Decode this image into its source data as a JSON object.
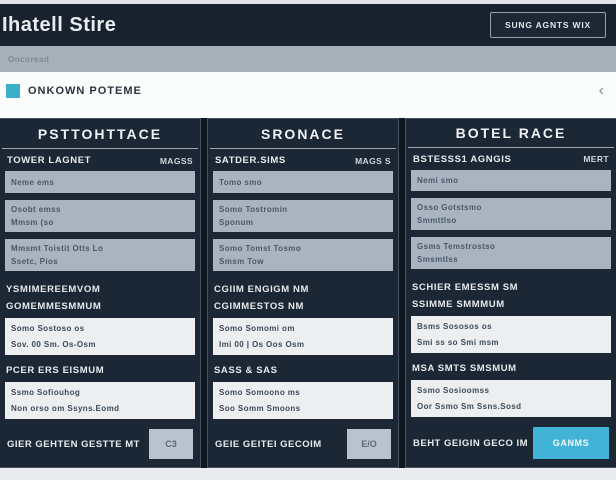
{
  "header": {
    "title": "Ihatell Stire",
    "action_button": "SUNG AGNTS WIX"
  },
  "breadcrumb": {
    "label": "Oncoread"
  },
  "section_bar": {
    "label": "ONKOWN POTEME",
    "chevron": "‹"
  },
  "columns": [
    {
      "title": "PSTTOHTTACE",
      "sub_left": "TOWER LAGNET",
      "sub_right": "MAGSS",
      "items": [
        {
          "line1": "Neme ems",
          "line2": ""
        },
        {
          "line1": "Osobt emss",
          "line2": "Mmsm (so"
        },
        {
          "line1": "Mmsmt Toistit Otts Lo",
          "line2": "Ssetc, Pios"
        }
      ],
      "section1": {
        "line1": "YSMIMEREEMVOM",
        "line2": "GOMEMMESMMUM"
      },
      "detail1": {
        "line1": "Somo Sostoso os",
        "line2": "Sov. 00 Sm. Os-Osm"
      },
      "section2": {
        "line1": "PCER ERS EISMUM"
      },
      "detail2": {
        "line1": "Ssmo Sofiouhog",
        "line2": "Non orso om Ssyns.Eomd"
      },
      "footer_label": "GIER GEHTEN GESTTE MT",
      "footer_button": "C3"
    },
    {
      "title": "SRONACE",
      "sub_left": "SATDER.SIMS",
      "sub_right": "MAGS S",
      "items": [
        {
          "line1": "Tomo smo",
          "line2": ""
        },
        {
          "line1": "Somo Tostromin",
          "line2": "Sponum"
        },
        {
          "line1": "Somo Tomst Tosmo",
          "line2": "Smsm Tow"
        }
      ],
      "section1": {
        "line1": "CGIIM ENGIGM NM",
        "line2": "CGIMMESTOS NM"
      },
      "detail1": {
        "line1": "Somo Somomi om",
        "line2": "Imi 00 | Os Oos Osm"
      },
      "section2": {
        "line1": "SASS & SAS"
      },
      "detail2": {
        "line1": "Somo Somoono ms",
        "line2": "Soo Somm Smoons"
      },
      "footer_label": "GEIE GEITEI GECOIM",
      "footer_button": "E/O"
    },
    {
      "title": "BOTEL RACE",
      "sub_left": "BSTESSS1 AGNGIS",
      "sub_right": "MERT",
      "items": [
        {
          "line1": "Nemi smo",
          "line2": ""
        },
        {
          "line1": "Osso Gotstsmo",
          "line2": "Smmttlso"
        },
        {
          "line1": "Gsms Temstrostso",
          "line2": "Smsmtlss"
        }
      ],
      "section1": {
        "line1": "SCHIER EMESSM SM",
        "line2": "SSIMME SMMMUM"
      },
      "detail1": {
        "line1": "Bsms Sososos os",
        "line2": "Smi ss so Smi msm"
      },
      "section2": {
        "line1": "MSA SMTS SMSMUM"
      },
      "detail2": {
        "line1": "Ssmo Sosioomss",
        "line2": "Oor Ssmo Sm Ssns.Sosd"
      },
      "footer_label": "BEHT GEIGIN GECO IM",
      "footer_button": "GANMS"
    }
  ],
  "colors": {
    "header_bg": "#18222f",
    "card_bg": "#1c2735",
    "gray_bar": "#a6b0b9",
    "feature_row": "#a9b4c0",
    "detail_row": "#eceeef",
    "accent_cyan": "#41b3d6",
    "teal_icon": "#3ab0c8",
    "gray_button": "#b9c3cd"
  }
}
